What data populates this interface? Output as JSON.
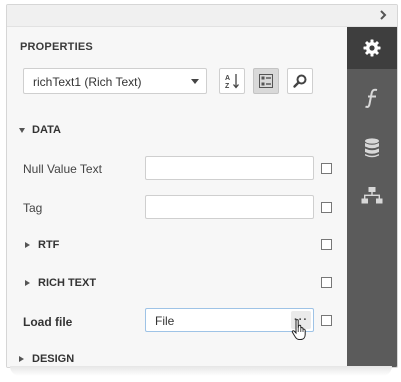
{
  "panel": {
    "title": "PROPERTIES",
    "component_select": {
      "value": "richText1 (Rich Text)"
    },
    "toolbar": {
      "sort_icon": "sort-alphabetical-icon",
      "categories_icon": "categorized-view-icon",
      "search_icon": "search-icon",
      "categories_pressed": true
    },
    "sections": {
      "data": {
        "label": "DATA",
        "expanded": true
      },
      "rtf": {
        "label": "RTF",
        "expanded": false
      },
      "rich_text": {
        "label": "RICH TEXT",
        "expanded": false
      },
      "design": {
        "label": "DESIGN",
        "expanded": false
      }
    },
    "rows": {
      "null_value_text": {
        "label": "Null Value Text",
        "value": ""
      },
      "tag": {
        "label": "Tag",
        "value": ""
      },
      "load_file": {
        "label": "Load file",
        "value": "File",
        "button_label": "···"
      }
    }
  },
  "side_tabs": [
    {
      "icon": "gear-icon",
      "active": true
    },
    {
      "icon": "function-icon",
      "active": false
    },
    {
      "icon": "database-icon",
      "active": false
    },
    {
      "icon": "hierarchy-icon",
      "active": false
    }
  ],
  "colors": {
    "sidebar_bg": "#5b5b5b",
    "active_tab_bg": "#3e3e3e",
    "panel_bg": "#f7f7f7"
  }
}
